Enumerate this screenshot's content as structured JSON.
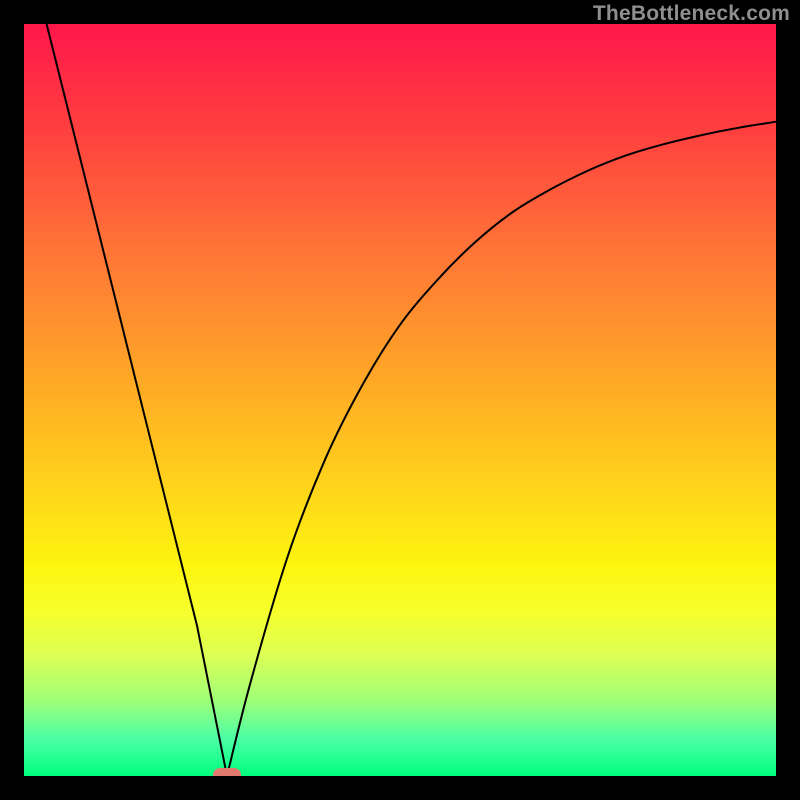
{
  "watermark": "TheBottleneck.com",
  "gradient_colors": {
    "top": "#ff174b",
    "mid_upper": "#ffa726",
    "mid": "#fcf50e",
    "bottom": "#00ff7f"
  },
  "chart_data": {
    "type": "line",
    "title": "",
    "xlabel": "",
    "ylabel": "",
    "xlim": [
      0,
      100
    ],
    "ylim": [
      0,
      100
    ],
    "notes": "V-shaped bottleneck curve. x = component balance percentage, y = mismatch percentage (0 at the minimum). Background gradient maps y: ~0 green through yellow/orange to red at 100.",
    "minimum_x": 27,
    "marker_x": 27,
    "series": [
      {
        "name": "left-branch",
        "x": [
          3,
          8,
          13,
          18,
          23,
          27
        ],
        "values": [
          100,
          80,
          60,
          40,
          20,
          0
        ]
      },
      {
        "name": "right-branch",
        "x": [
          27,
          30,
          35,
          40,
          45,
          50,
          55,
          60,
          65,
          70,
          75,
          80,
          85,
          90,
          95,
          100
        ],
        "values": [
          0,
          12,
          29,
          42,
          52,
          60,
          66,
          71,
          75,
          78,
          80.5,
          82.5,
          84,
          85.2,
          86.2,
          87
        ]
      }
    ]
  }
}
